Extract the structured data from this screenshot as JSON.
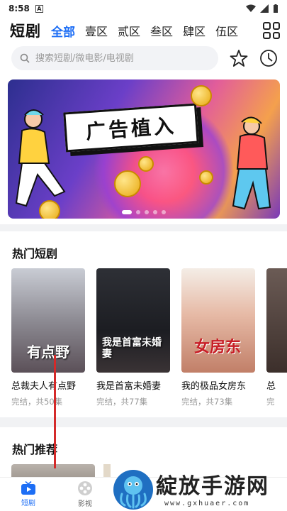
{
  "status_bar": {
    "time": "8:58",
    "notif_glyph": "A"
  },
  "header": {
    "brand": "短剧",
    "tabs": [
      {
        "label": "全部",
        "active": true
      },
      {
        "label": "壹区",
        "active": false
      },
      {
        "label": "贰区",
        "active": false
      },
      {
        "label": "叁区",
        "active": false
      },
      {
        "label": "肆区",
        "active": false
      },
      {
        "label": "伍区",
        "active": false
      }
    ],
    "grid_icon": "grid-icon"
  },
  "search": {
    "placeholder": "搜索短剧/微电影/电视剧",
    "icons": [
      "star-icon",
      "clock-icon"
    ]
  },
  "banner": {
    "text": "广告植入",
    "dots": 5,
    "active_dot": 0
  },
  "hot_shorts": {
    "title": "热门短剧",
    "items": [
      {
        "name": "总裁夫人有点野",
        "meta": "完结，共50集",
        "poster_text": "有点野"
      },
      {
        "name": "我是首富未婚妻",
        "meta": "完结，共77集",
        "poster_text": "我是首富未婚妻"
      },
      {
        "name": "我的极品女房东",
        "meta": "完结，共73集",
        "poster_text": "女房东"
      },
      {
        "name": "总",
        "meta": "完",
        "poster_text": ""
      }
    ]
  },
  "hot_recommend": {
    "title": "热门推荐"
  },
  "bottom_nav": [
    {
      "label": "短剧",
      "icon": "tv-icon",
      "active": true
    },
    {
      "label": "影视",
      "icon": "film-reel-icon",
      "active": false
    }
  ],
  "watermark": {
    "text": "綻放手游网",
    "url": "www.gxhuaer.com"
  },
  "colors": {
    "accent": "#1d6ef5",
    "muted": "#999999"
  }
}
